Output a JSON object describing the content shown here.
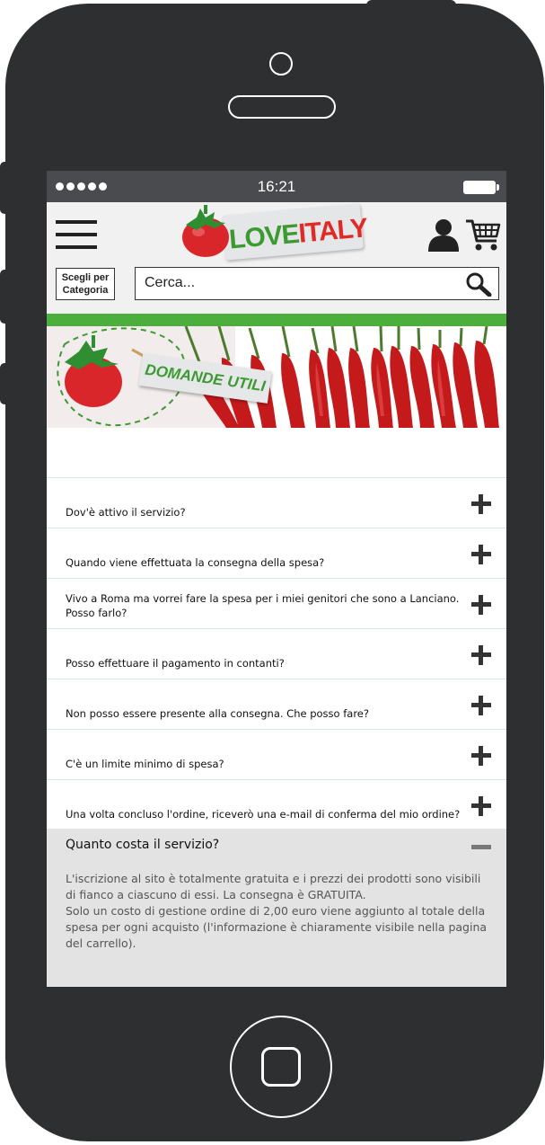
{
  "status_bar": {
    "time": "16:21"
  },
  "header": {
    "logo_part1": "LOVE",
    "logo_part2": "ITALY",
    "category_line1": "Scegli per",
    "category_line2": "Categoria",
    "search_placeholder": "Cerca..."
  },
  "hero": {
    "label": "DOMANDE UTILI"
  },
  "faq": {
    "items": [
      {
        "question": "Dov'è attivo il servizio?"
      },
      {
        "question": "Quando viene effettuata la consegna della spesa?"
      },
      {
        "question": "Vivo a Roma ma vorrei fare la spesa per i miei genitori che sono a Lanciano. Posso farlo?"
      },
      {
        "question": "Posso effettuare il pagamento in contanti?"
      },
      {
        "question": "Non posso essere presente alla consegna. Che posso fare?"
      },
      {
        "question": "C'è un limite minimo di spesa?"
      },
      {
        "question": "Una volta concluso l'ordine, riceverò una e-mail di conferma del mio ordine?"
      }
    ],
    "open_item": {
      "question": "Quanto costa il servizio?",
      "answer_line1": "L'iscrizione al sito è totalmente gratuita e i prezzi dei prodotti sono visibili di fianco a ciascuno di essi. La consegna è GRATUITA.",
      "answer_line2": "Solo un costo di gestione ordine di 2,00 euro viene aggiunto al totale della spesa per  ogni acquisto (l'informazione è chiaramente visibile nella pagina del carrello)."
    }
  },
  "colors": {
    "phone": "#2e2f31",
    "status_bar": "#4a4b4e",
    "brand_green": "#4bae3d",
    "brand_red": "#e02a27",
    "open_item_bg": "#e3e3e3"
  },
  "icons": [
    "hamburger-menu-icon",
    "user-icon",
    "cart-icon",
    "search-icon",
    "plus-icon",
    "minus-icon",
    "tomato-logo-icon"
  ]
}
